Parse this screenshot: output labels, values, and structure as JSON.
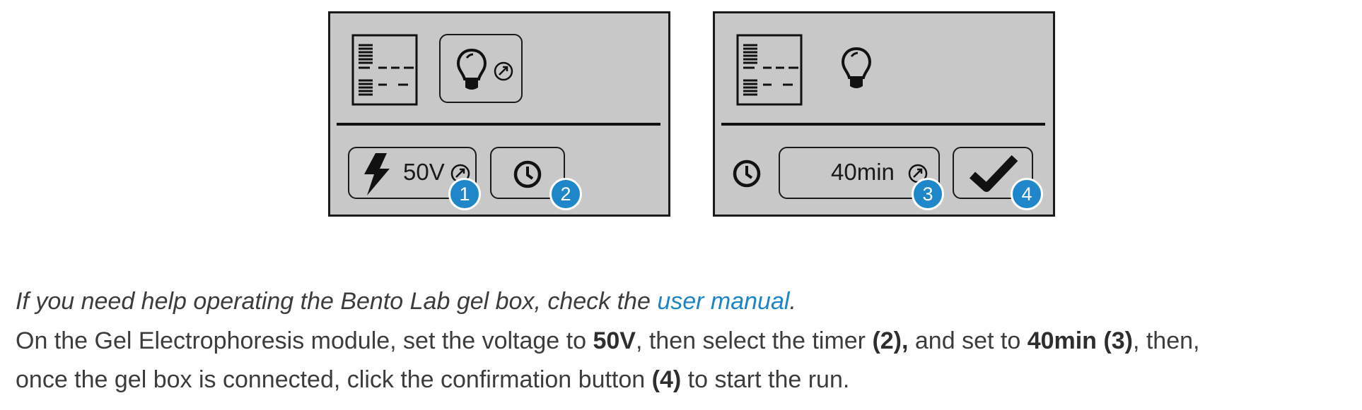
{
  "panels": {
    "setup": {
      "voltage_value": "50V",
      "voltage_badge": "1",
      "timer_badge": "2"
    },
    "timer": {
      "time_value": "40min",
      "time_badge": "3",
      "confirm_badge": "4"
    }
  },
  "icons": {
    "gel_lanes": "gel-lanes-icon",
    "light_bulb": "light-bulb-icon",
    "adjust": "adjust-dial-icon",
    "voltage": "lightning-bolt-icon",
    "clock": "clock-icon",
    "confirm": "checkmark-icon"
  },
  "colors": {
    "panel_bg": "#c8c8c8",
    "badge": "#1f87c9",
    "link": "#1d84c6",
    "text": "#3c3c3c"
  },
  "instructions": {
    "help": {
      "before": "If you need help operating the Bento Lab gel box, check the ",
      "link": "user manual",
      "after": "."
    },
    "step_line_1": {
      "t1": "On the Gel Electrophoresis module, set the voltage to ",
      "b1": "50V",
      "t2": ", then select the timer ",
      "b2": "(2),",
      "t3": " and set to ",
      "b3": "40min (3)",
      "t4": ", then,"
    },
    "step_line_2": {
      "t1": "once the gel box is connected, click the confirmation button ",
      "b1": "(4)",
      "t2": " to start the run."
    }
  }
}
